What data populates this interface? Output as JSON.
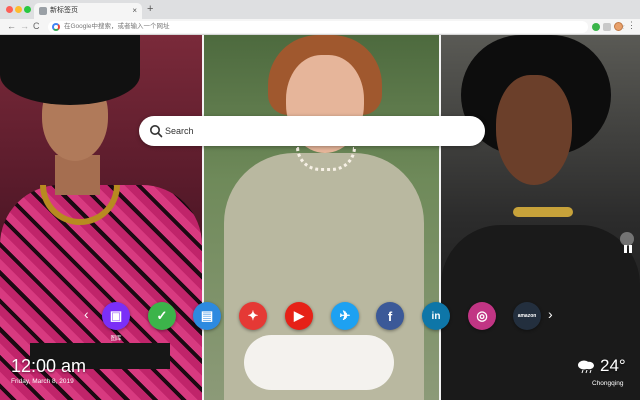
{
  "browser": {
    "tab_title": "新标签页",
    "tab_close": "×",
    "new_tab": "+",
    "address_placeholder": "在Google中搜索，或者输入一个网址"
  },
  "search": {
    "placeholder": "Search"
  },
  "shortcuts": [
    {
      "name": "图库",
      "icon": "gallery-icon",
      "color": "#7b2ff7",
      "glyph": "▣",
      "label": "图库"
    },
    {
      "name": "Tasks",
      "icon": "check-icon",
      "color": "#3cb44a",
      "glyph": "✓"
    },
    {
      "name": "News",
      "icon": "news-icon",
      "color": "#2d8ae0",
      "glyph": "▤"
    },
    {
      "name": "Games",
      "icon": "gamepad-icon",
      "color": "#e53935",
      "glyph": "✦"
    },
    {
      "name": "YouTube",
      "icon": "youtube-icon",
      "color": "#e62117",
      "glyph": "▶"
    },
    {
      "name": "Twitter",
      "icon": "twitter-icon",
      "color": "#1da1f2",
      "glyph": "✈"
    },
    {
      "name": "Facebook",
      "icon": "facebook-icon",
      "color": "#3b5998",
      "glyph": "f"
    },
    {
      "name": "LinkedIn",
      "icon": "linkedin-icon",
      "color": "#0e76a8",
      "glyph": "in"
    },
    {
      "name": "Instagram",
      "icon": "instagram-icon",
      "color": "#c13584",
      "glyph": "◎"
    },
    {
      "name": "Amazon",
      "icon": "amazon-icon",
      "color": "#232f3e",
      "glyph": "amazon"
    }
  ],
  "clock": {
    "time": "12:00 am",
    "date": "Friday, March 8, 2019"
  },
  "weather": {
    "temp": "24°",
    "city": "Chongqing",
    "icon": "cloud-rain-icon"
  }
}
